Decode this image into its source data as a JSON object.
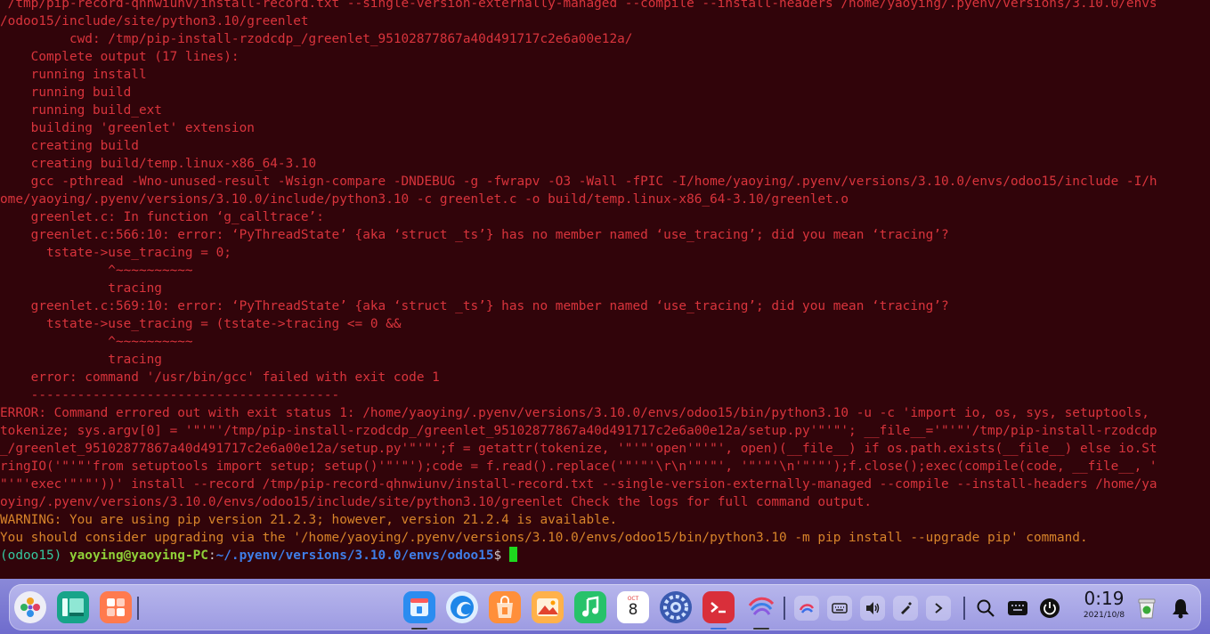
{
  "terminal": {
    "lines": [
      " /tmp/pip-record-qhnwiunv/install-record.txt --single-version-externally-managed --compile --install-headers /home/yaoying/.pyenv/versions/3.10.0/envs",
      "/odoo15/include/site/python3.10/greenlet",
      "         cwd: /tmp/pip-install-rzodcdp_/greenlet_95102877867a40d491717c2e6a00e12a/",
      "    Complete output (17 lines):",
      "    running install",
      "    running build",
      "    running build_ext",
      "    building 'greenlet' extension",
      "    creating build",
      "    creating build/temp.linux-x86_64-3.10",
      "    gcc -pthread -Wno-unused-result -Wsign-compare -DNDEBUG -g -fwrapv -O3 -Wall -fPIC -I/home/yaoying/.pyenv/versions/3.10.0/envs/odoo15/include -I/h",
      "ome/yaoying/.pyenv/versions/3.10.0/include/python3.10 -c greenlet.c -o build/temp.linux-x86_64-3.10/greenlet.o",
      "    greenlet.c: In function ‘g_calltrace’:",
      "    greenlet.c:566:10: error: ‘PyThreadState’ {aka ‘struct _ts’} has no member named ‘use_tracing’; did you mean ‘tracing’?",
      "      tstate->use_tracing = 0;",
      "              ^~~~~~~~~~~",
      "              tracing",
      "    greenlet.c:569:10: error: ‘PyThreadState’ {aka ‘struct _ts’} has no member named ‘use_tracing’; did you mean ‘tracing’?",
      "      tstate->use_tracing = (tstate->tracing <= 0 &&",
      "              ^~~~~~~~~~~",
      "              tracing",
      "    error: command '/usr/bin/gcc' failed with exit code 1",
      "    ----------------------------------------",
      "ERROR: Command errored out with exit status 1: /home/yaoying/.pyenv/versions/3.10.0/envs/odoo15/bin/python3.10 -u -c 'import io, os, sys, setuptools,",
      "tokenize; sys.argv[0] = '\"'\"'/tmp/pip-install-rzodcdp_/greenlet_95102877867a40d491717c2e6a00e12a/setup.py'\"'\"'; __file__='\"'\"'/tmp/pip-install-rzodcdp",
      "_/greenlet_95102877867a40d491717c2e6a00e12a/setup.py'\"'\"';f = getattr(tokenize, '\"'\"'open'\"'\"', open)(__file__) if os.path.exists(__file__) else io.St",
      "ringIO('\"'\"'from setuptools import setup; setup()'\"'\"');code = f.read().replace('\"'\"'\\r\\n'\"'\"', '\"'\"'\\n'\"'\"');f.close();exec(compile(code, __file__, '",
      "\"'\"'exec'\"'\"'))' install --record /tmp/pip-record-qhnwiunv/install-record.txt --single-version-externally-managed --compile --install-headers /home/ya",
      "oying/.pyenv/versions/3.10.0/envs/odoo15/include/site/python3.10/greenlet Check the logs for full command output."
    ],
    "warning_lines": [
      "WARNING: You are using pip version 21.2.3; however, version 21.2.4 is available.",
      "You should consider upgrading via the '/home/yaoying/.pyenv/versions/3.10.0/envs/odoo15/bin/python3.10 -m pip install --upgrade pip' command."
    ],
    "prompt": {
      "venv": "(odoo15)",
      "user_host": "yaoying@yaoying-PC",
      "sep": ":",
      "cwd": "~/.pyenv/versions/3.10.0/envs/odoo15",
      "symbol": "$"
    }
  },
  "taskbar": {
    "calendar_month": "OCT",
    "calendar_day": "8",
    "clock_time": "0:19",
    "clock_date": "2021/10/8"
  },
  "colors": {
    "terminal_bg": "#31040a",
    "error_text": "#d9343c",
    "warning_text": "#d8842a",
    "prompt_user": "#8fd038",
    "prompt_path": "#3f7ee8",
    "cursor": "#1ed81e"
  },
  "icons": {
    "dock_left": [
      "launcher-icon",
      "multitask-view-icon",
      "app-store-grid-icon"
    ],
    "dock_center": [
      "file-manager-icon",
      "browser-icon",
      "app-store-icon",
      "image-viewer-icon",
      "music-icon",
      "calendar-icon",
      "control-center-icon",
      "terminal-icon",
      "deepin-tools-icon"
    ],
    "tray": [
      "deepin-assistant-icon",
      "keyboard-icon",
      "volume-icon",
      "pen-icon",
      "expand-tray-icon"
    ],
    "system": [
      "search-icon",
      "onscreen-keyboard-icon",
      "power-icon",
      "trash-icon",
      "notification-bell-icon"
    ]
  }
}
